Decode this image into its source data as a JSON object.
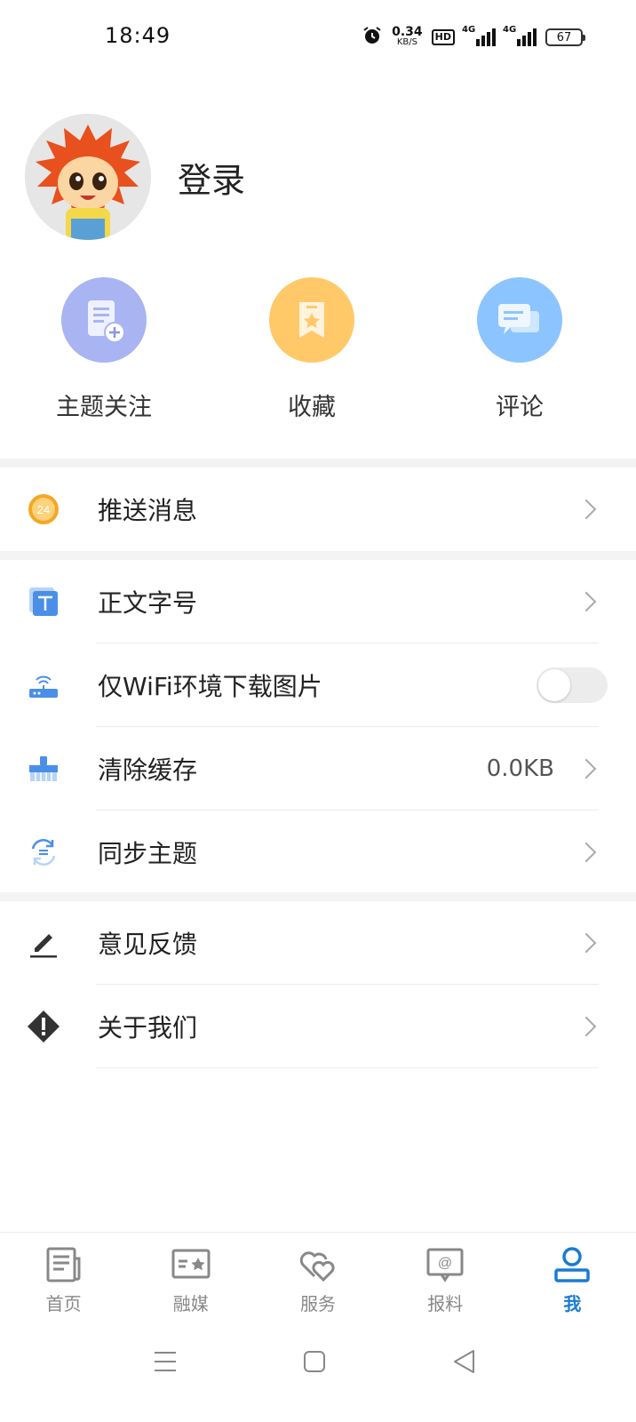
{
  "status_bar": {
    "time": "18:49",
    "net_speed_value": "0.34",
    "net_speed_unit": "KB/S",
    "hd_badge": "HD",
    "sig1_label": "4G",
    "sig2_label": "4G",
    "battery_level": "67"
  },
  "profile": {
    "login_label": "登录"
  },
  "quick_actions": [
    {
      "label": "主题关注",
      "icon": "document-add-icon",
      "color": "#a9b4f2"
    },
    {
      "label": "收藏",
      "icon": "bookmark-star-icon",
      "color": "#ffc96a"
    },
    {
      "label": "评论",
      "icon": "chat-bubbles-icon",
      "color": "#8cc4ff"
    }
  ],
  "menu": {
    "push": {
      "label": "推送消息",
      "icon": "clock-24-icon"
    },
    "font_size": {
      "label": "正文字号",
      "icon": "text-t-icon"
    },
    "wifi_images": {
      "label": "仅WiFi环境下载图片",
      "icon": "router-icon",
      "toggle_on": false
    },
    "clear_cache": {
      "label": "清除缓存",
      "value": "0.0KB",
      "icon": "brush-icon"
    },
    "sync_topics": {
      "label": "同步主题",
      "icon": "sync-icon"
    },
    "feedback": {
      "label": "意见反馈",
      "icon": "pencil-icon"
    },
    "about": {
      "label": "关于我们",
      "icon": "warning-diamond-icon"
    }
  },
  "bottom_nav": [
    {
      "label": "首页",
      "icon": "newspaper-icon",
      "active": false
    },
    {
      "label": "融媒",
      "icon": "media-card-icon",
      "active": false
    },
    {
      "label": "服务",
      "icon": "hearts-icon",
      "active": false
    },
    {
      "label": "报料",
      "icon": "at-message-icon",
      "active": false
    },
    {
      "label": "我",
      "icon": "user-icon",
      "active": true
    }
  ],
  "colors": {
    "accent": "#1a7bd2",
    "icon_blue": "#4a8fe7",
    "icon_orange": "#f5a623"
  }
}
